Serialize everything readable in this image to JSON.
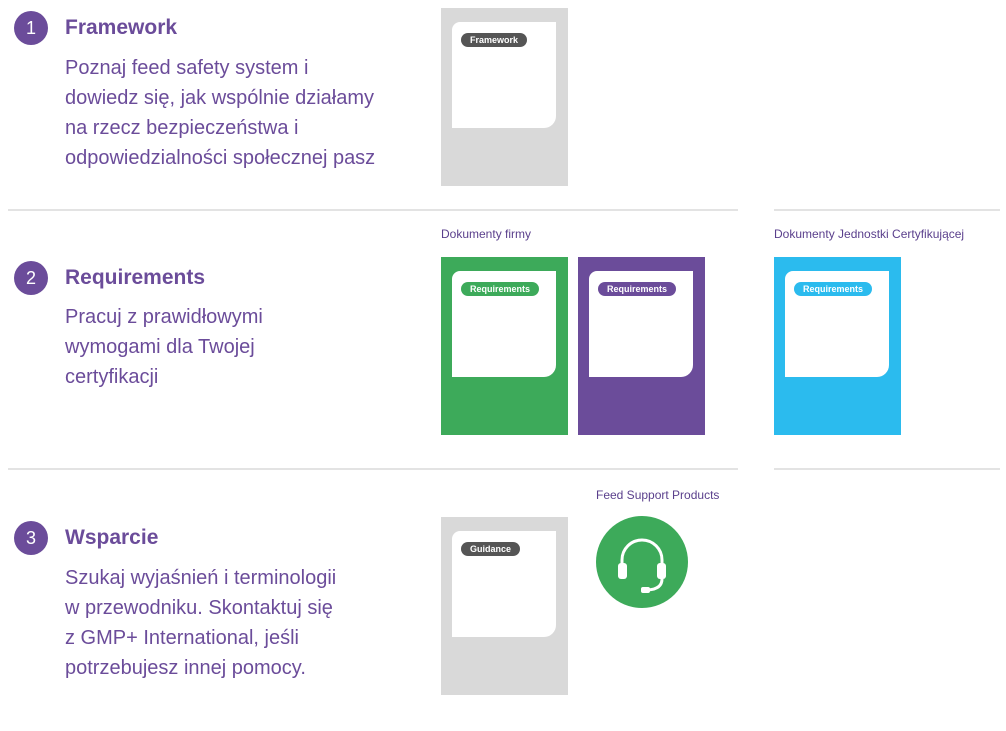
{
  "sections": [
    {
      "number": "1",
      "title": "Framework",
      "description": [
        "Poznaj feed safety system i",
        "dowiedz się, jak wspólnie działamy",
        "na rzecz bezpieczeństwa i",
        "odpowiedzialności społecznej pasz"
      ],
      "cards": [
        {
          "badge": "Framework",
          "color": "#d9d9d9",
          "badge_color": "#555555"
        }
      ]
    },
    {
      "number": "2",
      "title": "Requirements",
      "description": [
        "Pracuj z prawidłowymi",
        "wymogami dla Twojej",
        "certyfikacji"
      ],
      "group_labels": [
        "Dokumenty firmy",
        "Dokumenty Jednostki Certyfikującej"
      ],
      "cards": [
        {
          "badge": "Requirements",
          "color": "#3daa5a",
          "badge_color": "#3daa5a"
        },
        {
          "badge": "Requirements",
          "color": "#6b4c9a",
          "badge_color": "#6b4c9a"
        },
        {
          "badge": "Requirements",
          "color": "#2bbbee",
          "badge_color": "#2bbbee"
        }
      ]
    },
    {
      "number": "3",
      "title": "Wsparcie",
      "description": [
        "Szukaj wyjaśnień i terminologii",
        "w przewodniku. Skontaktuj się",
        "z GMP+ International, jeśli",
        "potrzebujesz innej pomocy."
      ],
      "support_label": "Feed Support Products",
      "support_icon": "headset-icon",
      "cards": [
        {
          "badge": "Guidance",
          "color": "#d9d9d9",
          "badge_color": "#555555"
        }
      ]
    }
  ]
}
